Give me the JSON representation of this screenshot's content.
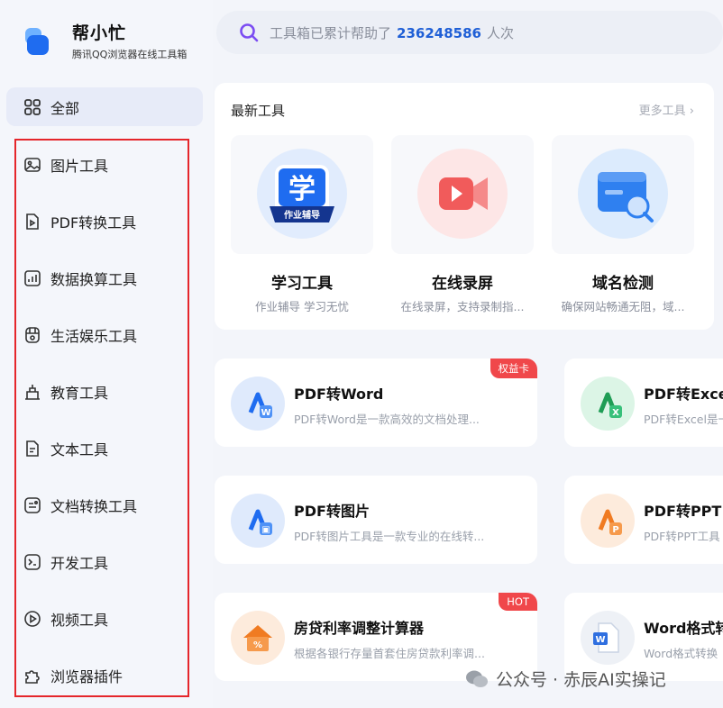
{
  "brand": {
    "name": "帮小忙",
    "subtitle": "腾讯QQ浏览器在线工具箱"
  },
  "search": {
    "prefix": "工具箱已累计帮助了",
    "count": "236248586",
    "suffix": "人次"
  },
  "sidebar": {
    "all_label": "全部",
    "items": [
      {
        "label": "图片工具",
        "icon": "image-icon"
      },
      {
        "label": "PDF转换工具",
        "icon": "pdf-icon"
      },
      {
        "label": "数据换算工具",
        "icon": "chart-icon"
      },
      {
        "label": "生活娱乐工具",
        "icon": "life-icon"
      },
      {
        "label": "教育工具",
        "icon": "education-icon"
      },
      {
        "label": "文本工具",
        "icon": "text-icon"
      },
      {
        "label": "文档转换工具",
        "icon": "document-convert-icon"
      },
      {
        "label": "开发工具",
        "icon": "terminal-icon"
      },
      {
        "label": "视频工具",
        "icon": "video-icon"
      },
      {
        "label": "浏览器插件",
        "icon": "puzzle-icon"
      }
    ]
  },
  "latest": {
    "title": "最新工具",
    "more": "更多工具",
    "more_chevron": "›",
    "tools": [
      {
        "title": "学习工具",
        "sub": "作业辅导 学习无忧",
        "icon_char": "学",
        "icon_caption": "作业辅导"
      },
      {
        "title": "在线录屏",
        "sub": "在线录屏，支持录制指..."
      },
      {
        "title": "域名检测",
        "sub": "确保网站畅通无阻，域..."
      }
    ]
  },
  "cards": [
    {
      "title": "PDF转Word",
      "desc": "PDF转Word是一款高效的文档处理...",
      "badge": "权益卡",
      "icon_letter": "W"
    },
    {
      "title": "PDF转Excel",
      "desc": "PDF转Excel是一款",
      "icon_letter": "X"
    },
    {
      "title": "PDF转图片",
      "desc": "PDF转图片工具是一款专业的在线转...",
      "icon_letter": "▣"
    },
    {
      "title": "PDF转PPT",
      "desc": "PDF转PPT工具",
      "icon_letter": "P"
    },
    {
      "title": "房贷利率调整计算器",
      "desc": "根据各银行存量首套住房贷款利率调...",
      "badge": "HOT",
      "icon_letter": "%"
    },
    {
      "title": "Word格式转",
      "desc": "Word格式转换",
      "icon_letter": "W"
    }
  ],
  "watermark": "公众号 · 赤辰AI实操记",
  "colors": {
    "accent": "#1f5fd6",
    "highlight_border": "#e5262b",
    "badge_red": "#f0474a"
  }
}
